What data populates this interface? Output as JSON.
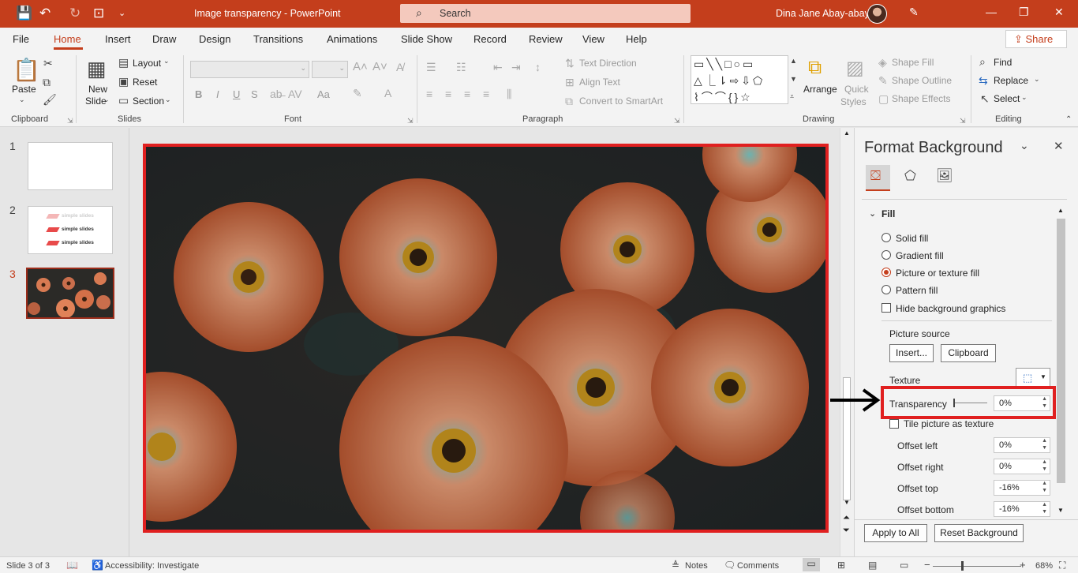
{
  "window": {
    "title": "Image transparency  -  PowerPoint",
    "search_placeholder": "Search",
    "user_name": "Dina Jane Abay-abay"
  },
  "menu": {
    "tabs": [
      "File",
      "Home",
      "Insert",
      "Draw",
      "Design",
      "Transitions",
      "Animations",
      "Slide Show",
      "Record",
      "Review",
      "View",
      "Help"
    ],
    "active": "Home",
    "share_label": "Share"
  },
  "ribbon": {
    "clipboard": {
      "paste": "Paste",
      "label": "Clipboard"
    },
    "slides": {
      "new_slide_1": "New",
      "new_slide_2": "Slide",
      "layout": "Layout",
      "reset": "Reset",
      "section": "Section",
      "label": "Slides"
    },
    "font": {
      "label": "Font",
      "bold": "B",
      "italic": "I",
      "underline": "U",
      "strike": "S",
      "case": "Aa"
    },
    "paragraph": {
      "text_direction": "Text Direction",
      "align_text": "Align Text",
      "convert_smartart": "Convert to SmartArt",
      "label": "Paragraph"
    },
    "drawing": {
      "arrange": "Arrange",
      "quick_styles_1": "Quick",
      "quick_styles_2": "Styles",
      "shape_fill": "Shape Fill",
      "shape_outline": "Shape Outline",
      "shape_effects": "Shape Effects",
      "label": "Drawing"
    },
    "editing": {
      "find": "Find",
      "replace": "Replace",
      "select": "Select",
      "label": "Editing"
    }
  },
  "thumbnails": [
    {
      "number": "1"
    },
    {
      "number": "2",
      "lines": [
        "simple slides",
        "simple slides",
        "simple slides"
      ]
    },
    {
      "number": "3"
    }
  ],
  "format_pane": {
    "title": "Format Background",
    "section": "Fill",
    "options": [
      "Solid fill",
      "Gradient fill",
      "Picture or texture fill",
      "Pattern fill"
    ],
    "selected_option": "Picture or texture fill",
    "hide_bg": "Hide background graphics",
    "picture_source": "Picture source",
    "insert_btn": "Insert...",
    "clipboard_btn": "Clipboard",
    "texture": "Texture",
    "transparency_label": "Transparency",
    "transparency_value": "0%",
    "tile": "Tile picture as texture",
    "offset_left_label": "Offset left",
    "offset_left": "0%",
    "offset_right_label": "Offset right",
    "offset_right": "0%",
    "offset_top_label": "Offset top",
    "offset_top": "-16%",
    "offset_bottom_label": "Offset bottom",
    "offset_bottom": "-16%",
    "apply_all": "Apply to All",
    "reset_bg": "Reset Background"
  },
  "status": {
    "slide_info": "Slide 3 of 3",
    "accessibility": "Accessibility: Investigate",
    "notes": "Notes",
    "comments": "Comments",
    "zoom": "68%"
  },
  "colors": {
    "accent": "#c43e1c",
    "highlight": "#e02020"
  }
}
